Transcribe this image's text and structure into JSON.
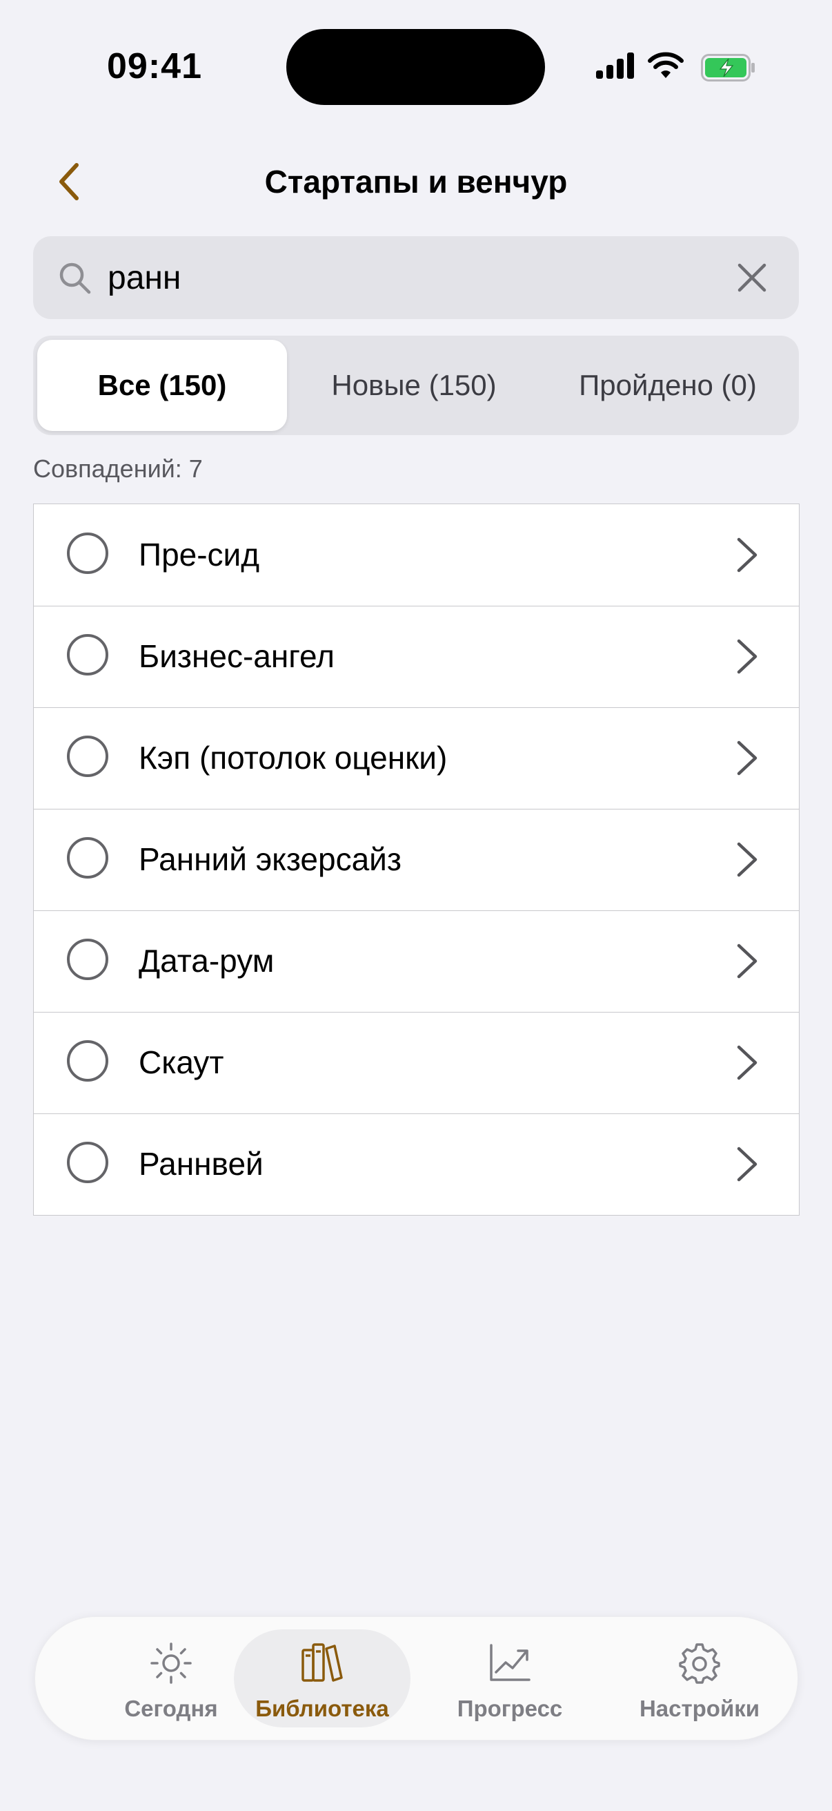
{
  "status_bar": {
    "time": "09:41",
    "icons": [
      "signal-icon",
      "wifi-icon",
      "battery-charging-icon"
    ]
  },
  "nav": {
    "back_icon": "chevron-left-icon",
    "title": "Стартапы и венчур"
  },
  "search": {
    "icon": "search-icon",
    "value": "ранн",
    "clear_icon": "close-icon"
  },
  "segments": [
    {
      "label": "Все (150)",
      "selected": true
    },
    {
      "label": "Новые (150)",
      "selected": false
    },
    {
      "label": "Пройдено (0)",
      "selected": false
    }
  ],
  "match_count": "Совпадений: 7",
  "items": [
    {
      "label": "Пре-сид"
    },
    {
      "label": "Бизнес-ангел"
    },
    {
      "label": "Кэп (потолок оценки)"
    },
    {
      "label": "Ранний экзерсайз"
    },
    {
      "label": "Дата-рум"
    },
    {
      "label": "Скаут"
    },
    {
      "label": "Раннвей"
    }
  ],
  "tabs": [
    {
      "label": "Сегодня",
      "icon": "sun-icon",
      "active": false
    },
    {
      "label": "Библиотека",
      "icon": "books-icon",
      "active": true
    },
    {
      "label": "Прогресс",
      "icon": "chart-icon",
      "active": false
    },
    {
      "label": "Настройки",
      "icon": "gear-icon",
      "active": false
    }
  ],
  "colors": {
    "accent": "#8a5a0c",
    "background": "#f2f2f7",
    "battery": "#34c759"
  }
}
